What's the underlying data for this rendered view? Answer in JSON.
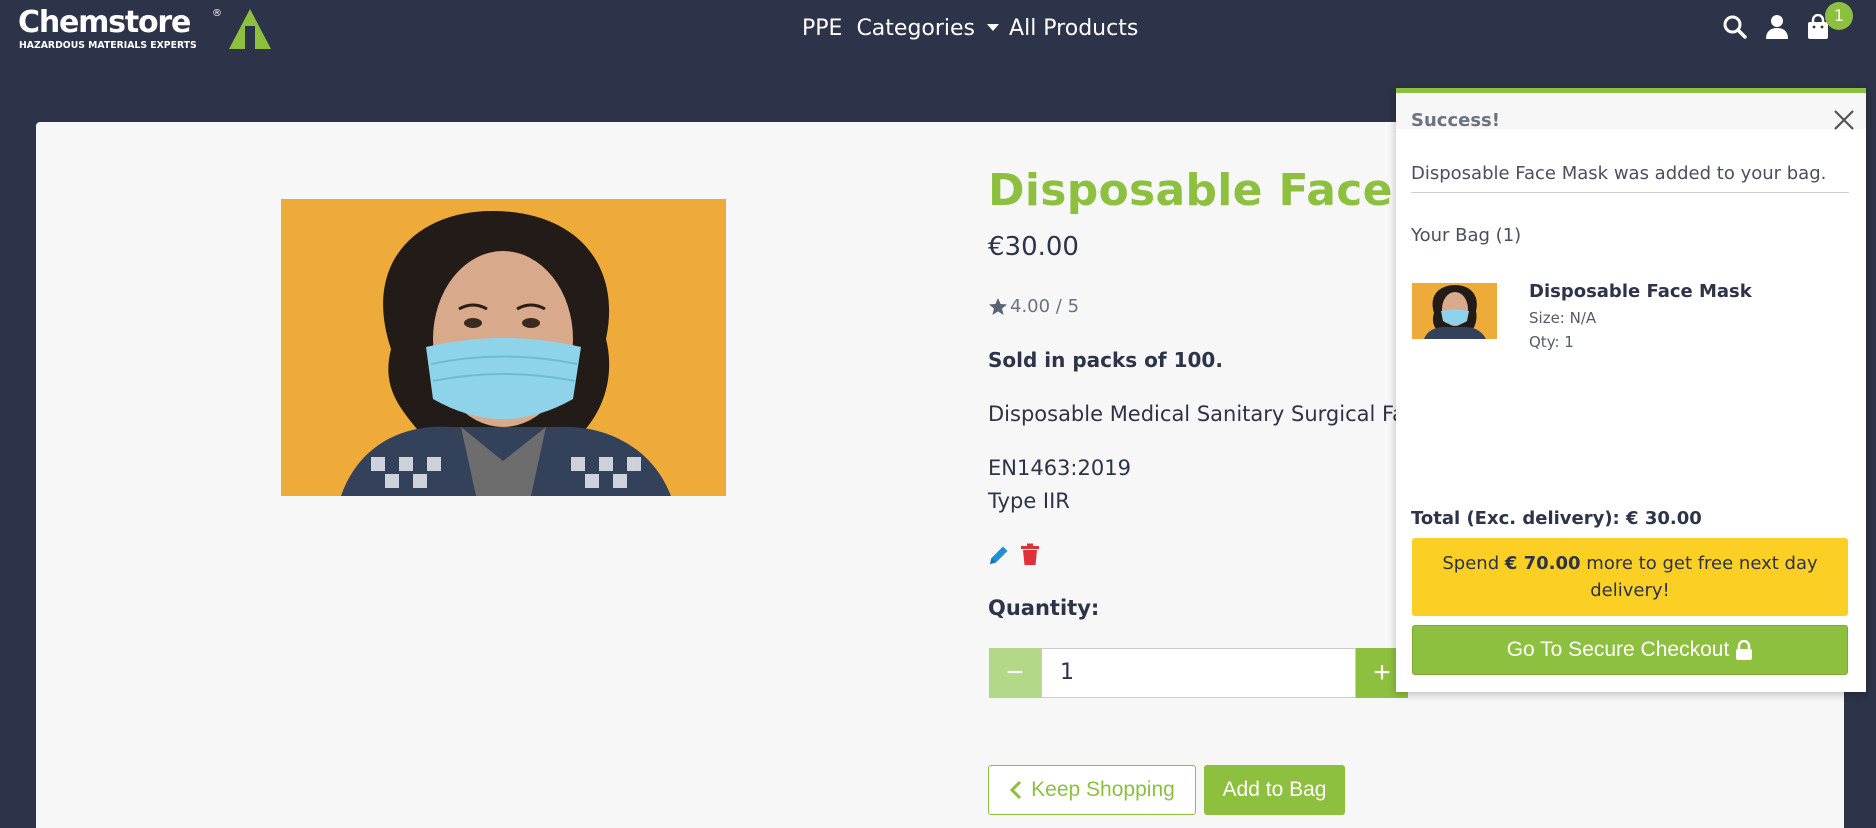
{
  "brand": {
    "name": "Chemstore",
    "registered": "®",
    "tagline": "HAZARDOUS MATERIALS EXPERTS"
  },
  "nav": {
    "ppe": "PPE",
    "categories": "Categories",
    "all_products": "All Products",
    "cart_count": "1"
  },
  "colors": {
    "primary_green": "#8dc03f",
    "navy": "#2d3348",
    "warning_yellow": "#fbcf24",
    "danger_red": "#e0303a",
    "edit_blue": "#1f8fd6"
  },
  "product": {
    "title": "Disposable Face M",
    "price": "€30.00",
    "rating": "4.00 / 5",
    "pack_note": "Sold in packs of 100.",
    "description": "Disposable Medical Sanitary Surgical Fac",
    "standard": "EN1463:2019",
    "type": "Type IIR",
    "quantity_label": "Quantity:",
    "quantity_value": "1",
    "keep_shopping": "Keep Shopping",
    "add_to_bag": "Add to Bag"
  },
  "popup": {
    "title": "Success!",
    "message": "Disposable Face Mask was added to your bag.",
    "bag_header": "Your Bag (1)",
    "item": {
      "name": "Disposable Face Mask",
      "size": "Size: N/A",
      "qty": "Qty: 1"
    },
    "total": "Total (Exc. delivery): € 30.00",
    "spend_prefix": "Spend ",
    "spend_amount": "€ 70.00",
    "spend_suffix": " more to get free next day delivery!",
    "checkout": "Go To Secure Checkout"
  }
}
